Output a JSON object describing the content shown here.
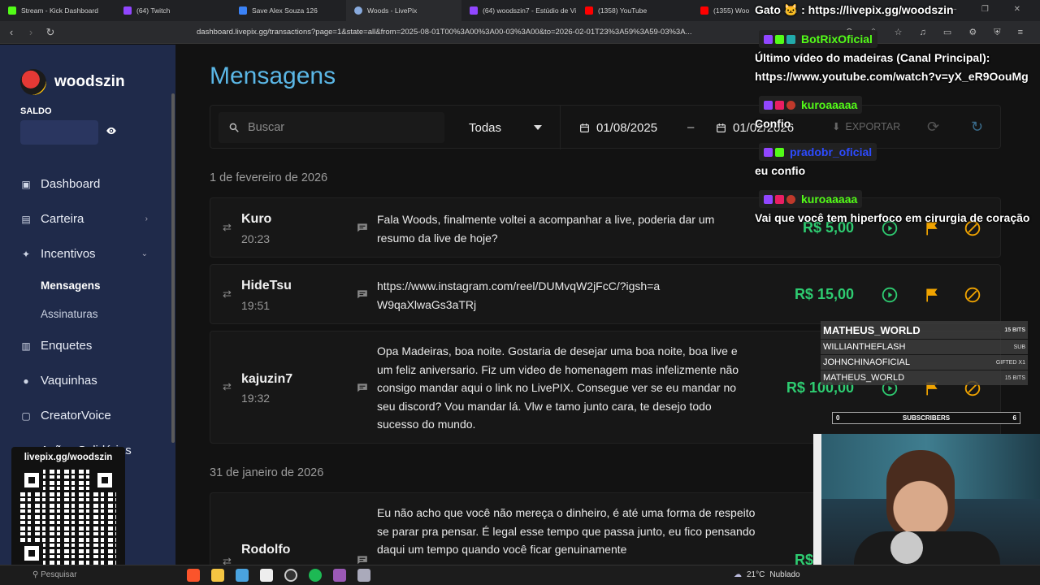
{
  "browser": {
    "tabs": [
      {
        "label": "Stream - Kick Dashboard",
        "color": "#53fc18"
      },
      {
        "label": "(64) Twitch",
        "color": "#9146ff"
      },
      {
        "label": "Save Alex Souza 126",
        "color": "#3b82f6"
      },
      {
        "label": "Woods - LivePix",
        "color": "#8ad"
      },
      {
        "label": "(64) woodszin7 - Estúdio de Vi",
        "color": "#9146ff"
      },
      {
        "label": "(1358) YouTube",
        "color": "#ff0000"
      },
      {
        "label": "(1355) Woo",
        "color": "#ff0000"
      }
    ],
    "url": "dashboard.livepix.gg/transactions?page=1&state=all&from=2025-08-01T00%3A00%3A00-03%3A00&to=2026-02-01T23%3A59%3A59-03%3A..."
  },
  "sidebar": {
    "brand": "woodszin",
    "saldo_label": "SALDO",
    "items": [
      {
        "label": "Dashboard",
        "icon": "dashboard-icon"
      },
      {
        "label": "Carteira",
        "icon": "wallet-icon"
      },
      {
        "label": "Incentivos",
        "icon": "sparkle-icon"
      },
      {
        "label": "Enquetes",
        "icon": "poll-icon"
      },
      {
        "label": "Vaquinhas",
        "icon": "piggy-icon"
      },
      {
        "label": "CreatorVoice",
        "icon": "voice-icon"
      },
      {
        "label": "Ações Solidárias",
        "icon": "heart-icon"
      }
    ],
    "subitems": [
      {
        "label": "Mensagens"
      },
      {
        "label": "Assinaturas"
      }
    ]
  },
  "qr": {
    "title": "livepix.gg/woodszin"
  },
  "main": {
    "title": "Mensagens",
    "search_placeholder": "Buscar",
    "filter_value": "Todas",
    "date_from": "01/08/2025",
    "date_to": "01/02/2026",
    "export_label": "EXPORTAR"
  },
  "groups": [
    {
      "date": "1 de fevereiro de 2026",
      "items": [
        {
          "name": "Kuro",
          "time": "20:23",
          "message": "Fala Woods, finalmente voltei a acompanhar a live, poderia dar um resumo da live de hoje?",
          "amount": "R$ 5,00"
        },
        {
          "name": "HideTsu",
          "time": "19:51",
          "message": "https://www.instagram.com/reel/DUMvqW2jFcC/?igsh=aW9qaXlwaGs3aTRj",
          "amount": "R$ 15,00"
        },
        {
          "name": "kajuzin7",
          "time": "19:32",
          "message": "Opa Madeiras, boa noite. Gostaria de desejar uma boa noite, boa live e um feliz aniversario. Fiz um video de homenagem mas infelizmente não consigo mandar aqui o link no LivePIX. Consegue ver se eu mandar no seu discord? Vou mandar lá. Vlw e tamo junto cara, te desejo todo sucesso do mundo.",
          "amount": "R$ 100,00"
        }
      ]
    },
    {
      "date": "31 de janeiro de 2026",
      "items": [
        {
          "name": "Rodolfo",
          "time": "",
          "message": "Eu não acho que você não mereça o dinheiro, é até uma forma de respeito se parar pra pensar. É legal esse tempo que passa junto, eu fico pensando daqui um tempo quando você ficar genuinamente",
          "amount": "R$"
        }
      ]
    }
  ],
  "chat": {
    "top_line": "Gato 🐱 : https://livepix.gg/woodszin",
    "messages": [
      {
        "user": "BotRixOficial",
        "user_color": "#53fc18",
        "text1": "Último vídeo do madeiras (Canal Principal):",
        "text2": "https://www.youtube.com/watch?v=yX_eR9OouMg"
      },
      {
        "user": "kuroaaaaa",
        "user_color": "#53fc18",
        "text1": "Confio",
        "text2": ""
      },
      {
        "user": "pradobr_oficial",
        "user_color": "#2d4bff",
        "text1": "eu confio",
        "text2": ""
      },
      {
        "user": "kuroaaaaa",
        "user_color": "#53fc18",
        "text1": "Vai que você tem hiperfoco em cirurgia de coração",
        "text2": ""
      }
    ]
  },
  "subs_widget": {
    "rows": [
      {
        "name": "MATHEUS_WORLD",
        "tag": "15 BITS"
      },
      {
        "name": "WILLIANTHEFLASH",
        "tag": "SUB"
      },
      {
        "name": "JOHNCHINAOFICIAL",
        "tag": "GIFTED X1"
      },
      {
        "name": "MATHEUS_WORLD",
        "tag": "15 BITS"
      }
    ],
    "count_left": "0",
    "count_label": "SUBSCRIBERS",
    "count_right": "6"
  },
  "taskbar": {
    "search": "Pesquisar",
    "temp": "21°C",
    "weather": "Nublado"
  }
}
